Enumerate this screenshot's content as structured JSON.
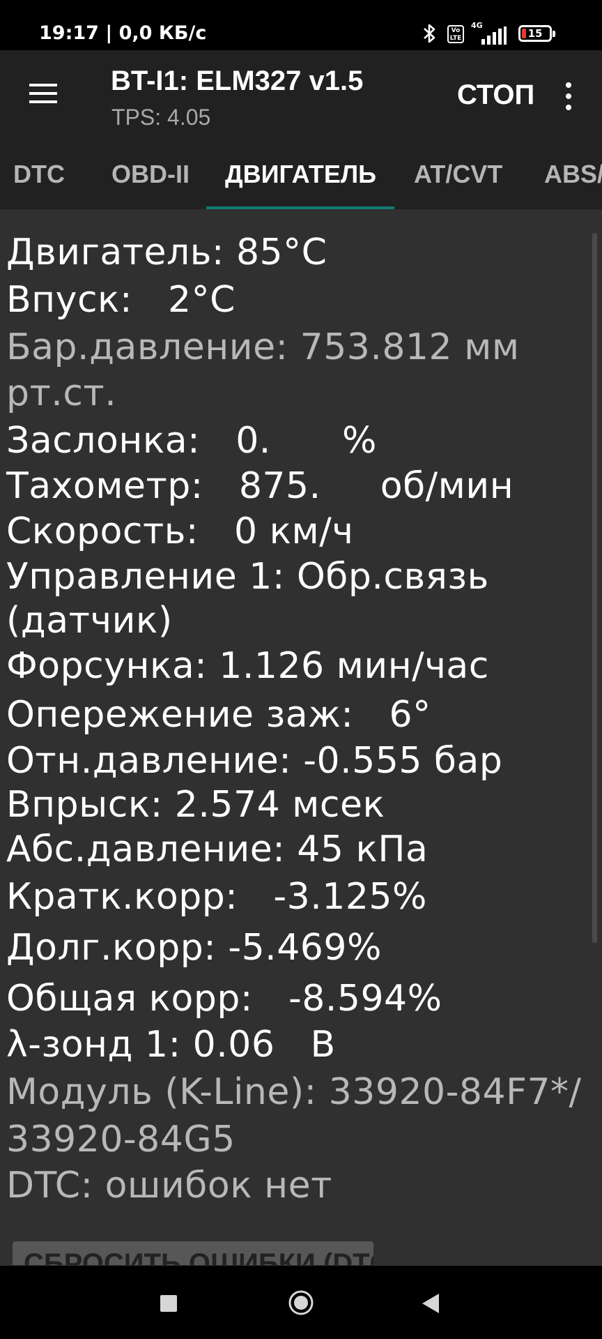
{
  "status_bar": {
    "time_text": "19:17 | 0,0 КБ/с",
    "network_label": "4G",
    "volte_label": "Vo LTE",
    "battery_level": "15",
    "icons": [
      "bluetooth-icon",
      "volte-icon",
      "signal-icon",
      "battery-icon"
    ]
  },
  "app_bar": {
    "title": "BT-I1: ELM327 v1.5",
    "subtitle": "TPS: 4.05",
    "stop_label": "СТОП",
    "menu_icon": "hamburger-menu-icon",
    "overflow_icon": "more-vert-icon"
  },
  "tabs": [
    {
      "label": "DTC",
      "active": false
    },
    {
      "label": "OBD-II",
      "active": false
    },
    {
      "label": "ДВИГАТЕЛЬ",
      "active": true
    },
    {
      "label": "AT/CVT",
      "active": false
    },
    {
      "label": "ABS/",
      "active": false
    }
  ],
  "readings": [
    "Двигатель: 85°C",
    "Впуск:   2°C",
    "Бар.давление: 753.812 мм",
    "рт.ст.",
    "Заслонка:   0.      %",
    "Тахометр:   875.     об/мин",
    "Скорость:   0 км/ч",
    "Управление 1: Обр.связь",
    "(датчик)",
    "Форсунка: 1.126 мин/час",
    "Опережение заж:   6°",
    "Отн.давление: -0.555 бар",
    "Впрыск: 2.574 мсек",
    "Абс.давление: 45 кПа",
    "Кратк.корр:   -3.125%",
    "Долг.корр: -5.469%",
    "Общая корр:   -8.594%",
    "λ-зонд 1: 0.06   В",
    "Модуль (K-Line): 33920-84F7*/",
    "33920-84G5",
    "DTC: ошибок нет"
  ],
  "reset_button_label": "СБРОСИТЬ ОШИБКИ (DTC)",
  "colors": {
    "background": "#303030",
    "app_bar": "#212121",
    "accent": "#0f7b74",
    "dim_text": "#b8b8b8"
  },
  "nav_bar": {
    "icons": [
      "recents-icon",
      "home-icon",
      "back-icon"
    ]
  }
}
